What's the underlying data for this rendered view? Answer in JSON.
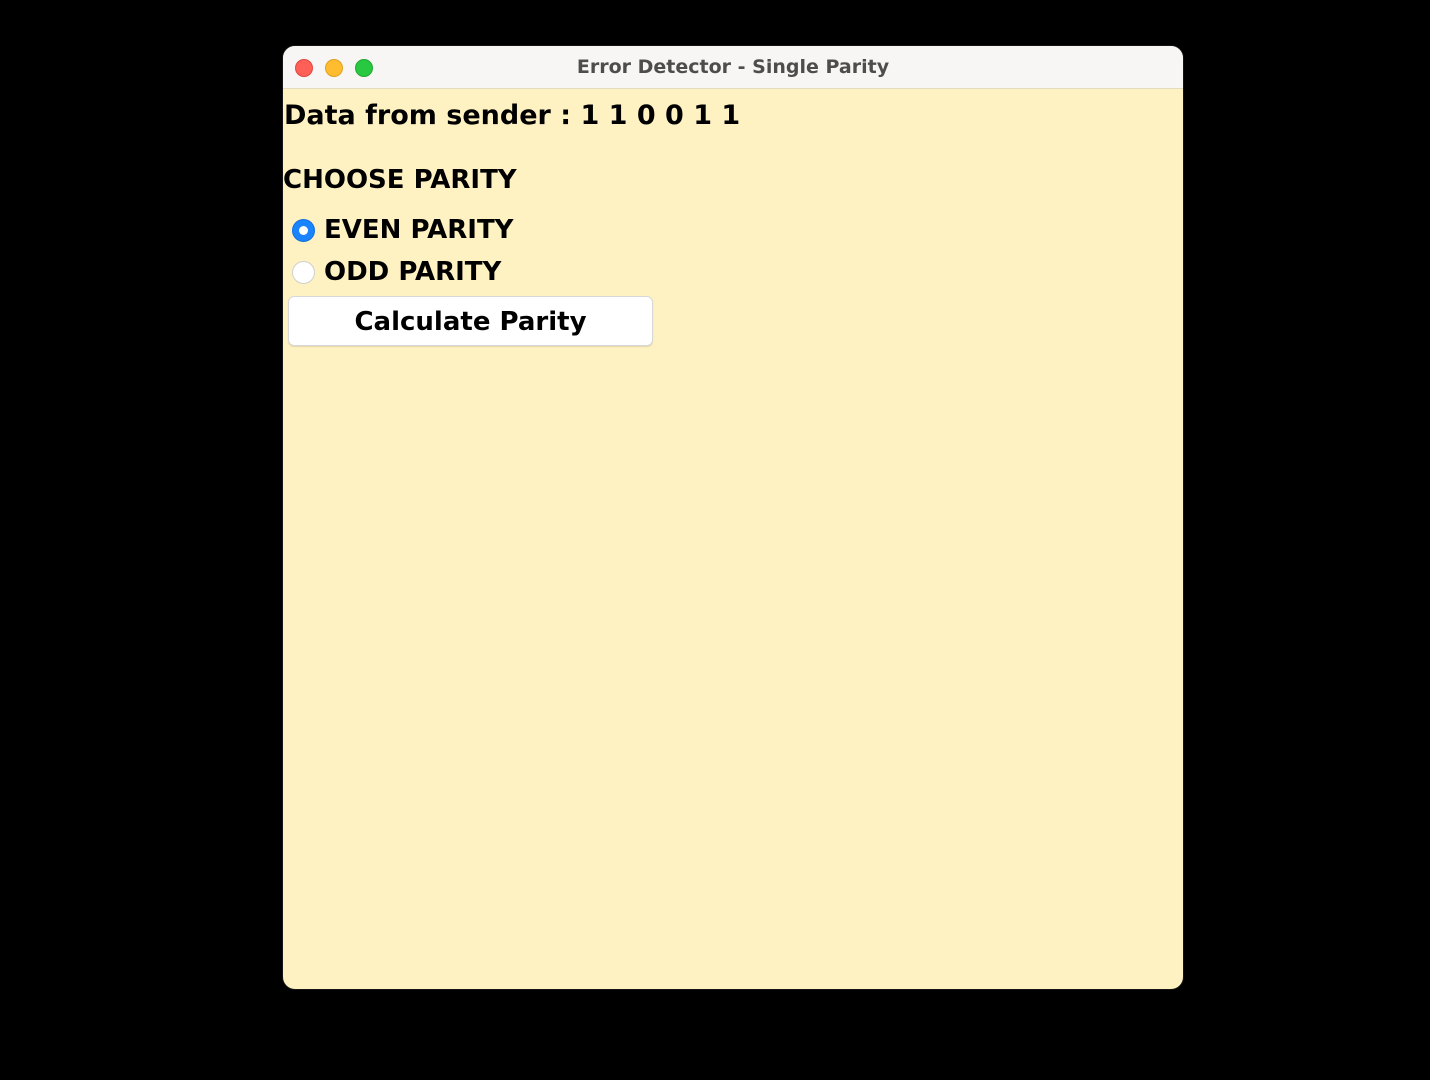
{
  "window": {
    "title": "Error Detector - Single Parity",
    "controls": {
      "close_color": "#fe5f57",
      "minimize_color": "#febc2e",
      "maximize_color": "#28c840"
    },
    "background_color": "#fff2c2"
  },
  "main": {
    "data_line": "Data from sender : 1 1 0 0 1 1",
    "choose_heading": "CHOOSE PARITY",
    "options": [
      {
        "label": "EVEN PARITY",
        "selected": true
      },
      {
        "label": "ODD PARITY",
        "selected": false
      }
    ],
    "calculate_label": "Calculate Parity",
    "accent_color": "#1a84ff"
  }
}
